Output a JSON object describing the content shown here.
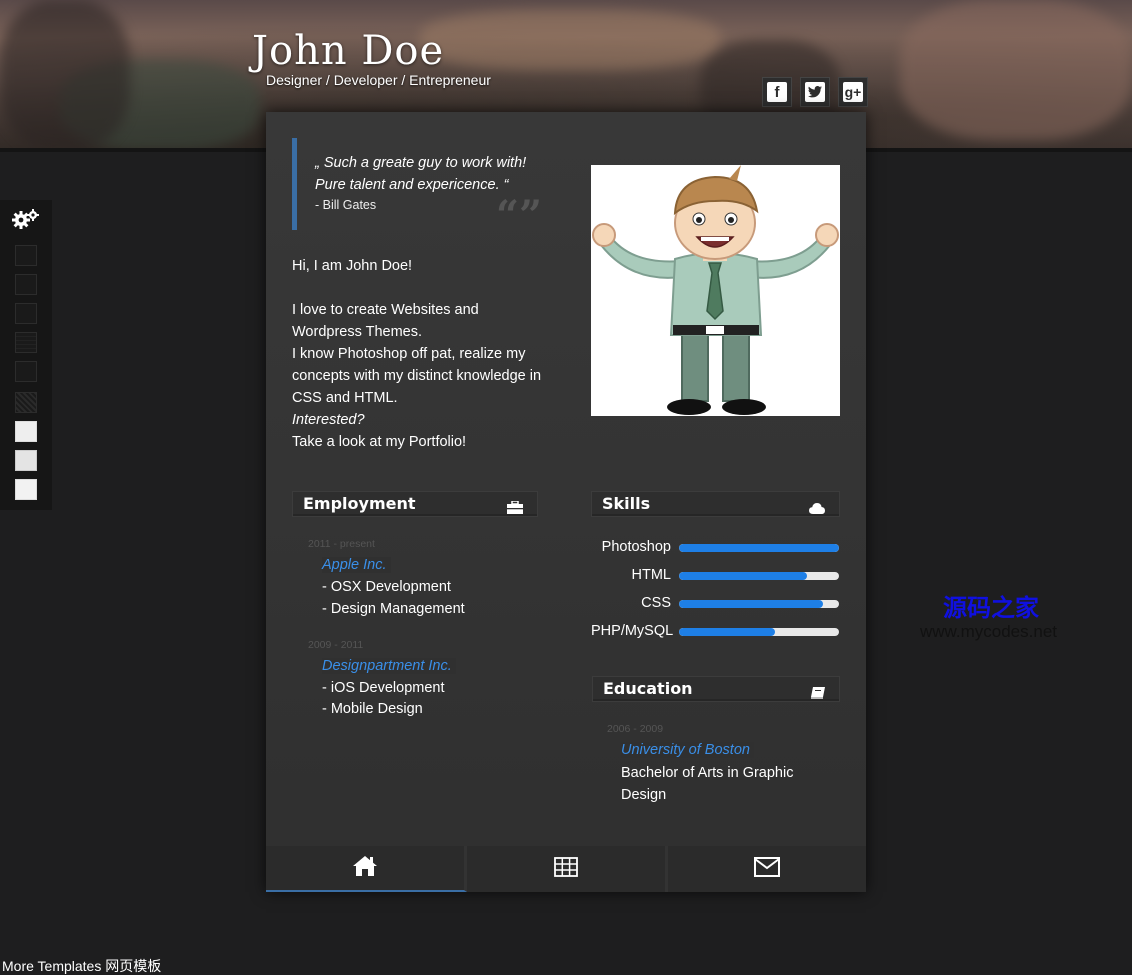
{
  "header": {
    "name": "John Doe",
    "tagline": "Designer / Developer / Entrepreneur",
    "social": [
      {
        "icon": "facebook-icon",
        "glyph": "f"
      },
      {
        "icon": "twitter-icon",
        "glyph": "t"
      },
      {
        "icon": "google-plus-icon",
        "glyph": "g+"
      }
    ]
  },
  "quote": {
    "text_line1": "„ Such a greate guy to work with!",
    "text_line2": "Pure talent and expericence. “",
    "author": "- Bill Gates"
  },
  "intro": {
    "greeting": "Hi, I am John Doe!",
    "line1": "I love to create Websites and Wordpress Themes.",
    "line2": "I know Photoshop off pat, realize my concepts with my distinct knowledge in CSS and HTML.",
    "line3": "Interested?",
    "line4": "Take a look at my Portfolio!"
  },
  "employment": {
    "title": "Employment",
    "jobs": [
      {
        "period": "2011 - present",
        "company": "Apple Inc.",
        "duties": [
          "- OSX Development",
          "- Design Management"
        ]
      },
      {
        "period": "2009 - 2011",
        "company": "Designpartment Inc.",
        "duties": [
          "- iOS Development",
          "- Mobile Design"
        ]
      }
    ]
  },
  "skills": {
    "title": "Skills",
    "items": [
      {
        "label": "Photoshop",
        "level": 1.0
      },
      {
        "label": "HTML",
        "level": 0.8
      },
      {
        "label": "CSS",
        "level": 0.9
      },
      {
        "label": "PHP/MySQL",
        "level": 0.6
      }
    ]
  },
  "education": {
    "title": "Education",
    "period": "2006 - 2009",
    "school": "University of Boston",
    "degree": "Bachelor of Arts in Graphic Design"
  },
  "nav": [
    {
      "icon": "home-icon",
      "active": true
    },
    {
      "icon": "grid-icon",
      "active": false
    },
    {
      "icon": "envelope-icon",
      "active": false
    }
  ],
  "watermark": {
    "cn": "源码之家",
    "url": "www.mycodes.net"
  },
  "footer": {
    "link": "More Templates 网页模板"
  },
  "colors": {
    "accent": "#1e7fe6",
    "link": "#3a8fe8",
    "border": "#3a6ea5"
  }
}
